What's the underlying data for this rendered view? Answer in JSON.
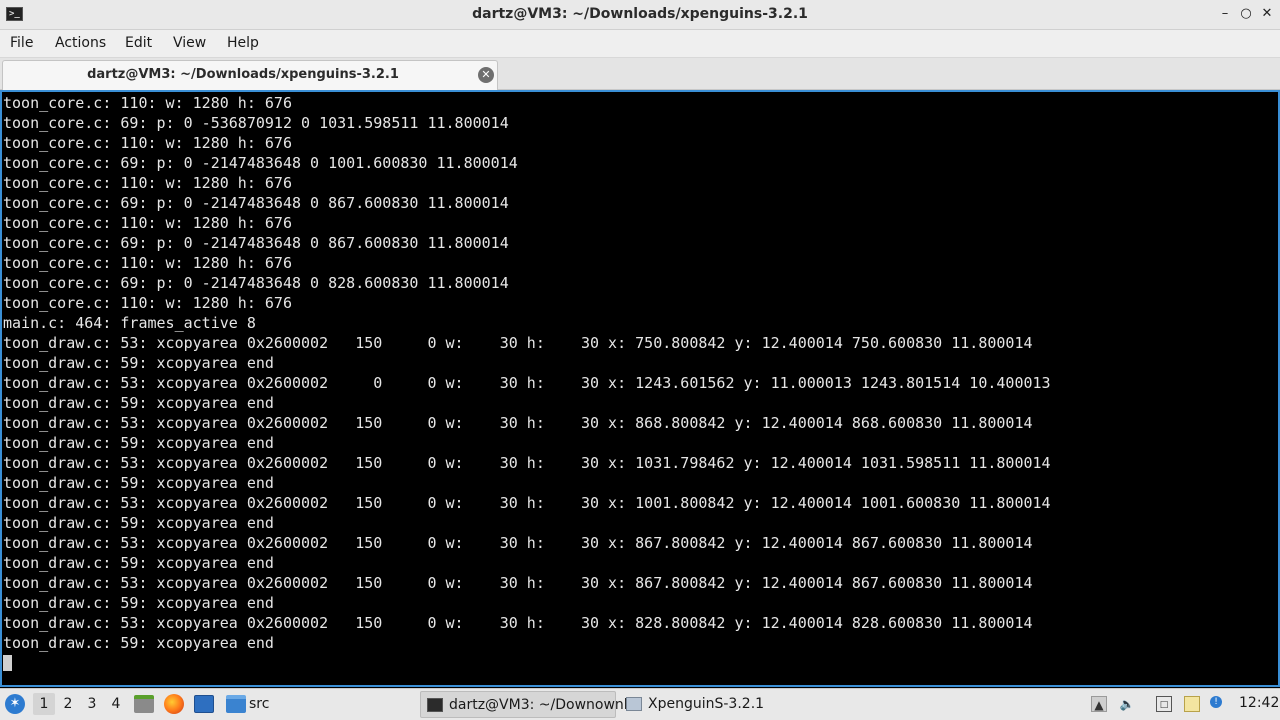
{
  "window": {
    "title": "dartz@VM3: ~/Downloads/xpenguins-3.2.1",
    "controls": [
      "minimize",
      "maximize",
      "close"
    ]
  },
  "menubar": {
    "items": [
      "File",
      "Actions",
      "Edit",
      "View",
      "Help"
    ]
  },
  "tabs": [
    {
      "label": "dartz@VM3: ~/Downloads/xpenguins-3.2.1",
      "active": true
    }
  ],
  "terminal": {
    "lines": [
      "toon_core.c: 110: w: 1280 h: 676",
      "toon_core.c: 69: p: 0 -536870912 0 1031.598511 11.800014",
      "toon_core.c: 110: w: 1280 h: 676",
      "toon_core.c: 69: p: 0 -2147483648 0 1001.600830 11.800014",
      "toon_core.c: 110: w: 1280 h: 676",
      "toon_core.c: 69: p: 0 -2147483648 0 867.600830 11.800014",
      "toon_core.c: 110: w: 1280 h: 676",
      "toon_core.c: 69: p: 0 -2147483648 0 867.600830 11.800014",
      "toon_core.c: 110: w: 1280 h: 676",
      "toon_core.c: 69: p: 0 -2147483648 0 828.600830 11.800014",
      "toon_core.c: 110: w: 1280 h: 676",
      "main.c: 464: frames_active 8",
      "toon_draw.c: 53: xcopyarea 0x2600002   150     0 w:    30 h:    30 x: 750.800842 y: 12.400014 750.600830 11.800014",
      "toon_draw.c: 59: xcopyarea end",
      "toon_draw.c: 53: xcopyarea 0x2600002     0     0 w:    30 h:    30 x: 1243.601562 y: 11.000013 1243.801514 10.400013",
      "toon_draw.c: 59: xcopyarea end",
      "toon_draw.c: 53: xcopyarea 0x2600002   150     0 w:    30 h:    30 x: 868.800842 y: 12.400014 868.600830 11.800014",
      "toon_draw.c: 59: xcopyarea end",
      "toon_draw.c: 53: xcopyarea 0x2600002   150     0 w:    30 h:    30 x: 1031.798462 y: 12.400014 1031.598511 11.800014",
      "toon_draw.c: 59: xcopyarea end",
      "toon_draw.c: 53: xcopyarea 0x2600002   150     0 w:    30 h:    30 x: 1001.800842 y: 12.400014 1001.600830 11.800014",
      "toon_draw.c: 59: xcopyarea end",
      "toon_draw.c: 53: xcopyarea 0x2600002   150     0 w:    30 h:    30 x: 867.800842 y: 12.400014 867.600830 11.800014",
      "toon_draw.c: 59: xcopyarea end",
      "toon_draw.c: 53: xcopyarea 0x2600002   150     0 w:    30 h:    30 x: 867.800842 y: 12.400014 867.600830 11.800014",
      "toon_draw.c: 59: xcopyarea end",
      "toon_draw.c: 53: xcopyarea 0x2600002   150     0 w:    30 h:    30 x: 828.800842 y: 12.400014 828.600830 11.800014",
      "toon_draw.c: 59: xcopyarea end"
    ],
    "text_color": "#e6e6e6",
    "background": "#000000",
    "border_accent": "#3a8fd6"
  },
  "taskbar": {
    "desktops": [
      "1",
      "2",
      "3",
      "4"
    ],
    "active_desktop": "1",
    "quicklaunch": [
      "file-manager-icon",
      "firefox-icon",
      "desktop-icon"
    ],
    "folder_label": "src",
    "tasks": [
      {
        "label": "dartz@VM3: ~/Downownl...",
        "active": true
      },
      {
        "label": "XpenguinS-3.2.1",
        "active": false
      }
    ],
    "clock": "12:42"
  }
}
